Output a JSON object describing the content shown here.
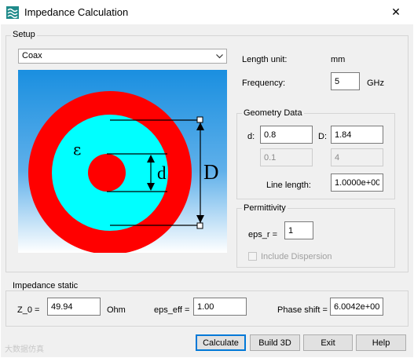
{
  "window": {
    "title": "Impedance Calculation",
    "close": "✕"
  },
  "setup": {
    "group_label": "Setup",
    "line_type": "Coax",
    "length_unit_label": "Length unit:",
    "length_unit_value": "mm",
    "frequency_label": "Frequency:",
    "frequency_value": "5",
    "frequency_unit": "GHz"
  },
  "diagram": {
    "epsilon_symbol": "ε",
    "d_symbol": "d",
    "D_symbol": "D"
  },
  "geometry": {
    "group_label": "Geometry Data",
    "d_label": "d:",
    "d_value": "0.8",
    "D_label": "D:",
    "D_value": "1.84",
    "d_disabled_value": "0.1",
    "D_disabled_value": "4",
    "line_length_label": "Line length:",
    "line_length_value": "1.0000e+00"
  },
  "permittivity": {
    "group_label": "Permittivity",
    "eps_r_label": "eps_r =",
    "eps_r_value": "1",
    "include_dispersion_label": "Include Dispersion"
  },
  "impedance": {
    "group_label": "Impedance static",
    "z0_label": "Z_0 =",
    "z0_value": "49.94",
    "z0_unit": "Ohm",
    "eps_eff_label": "eps_eff =",
    "eps_eff_value": "1.00",
    "phase_shift_label": "Phase shift =",
    "phase_shift_value": "6.0042e+00"
  },
  "buttons": {
    "calculate": "Calculate",
    "build3d": "Build 3D",
    "exit": "Exit",
    "help": "Help"
  },
  "watermark": "大数据仿真"
}
